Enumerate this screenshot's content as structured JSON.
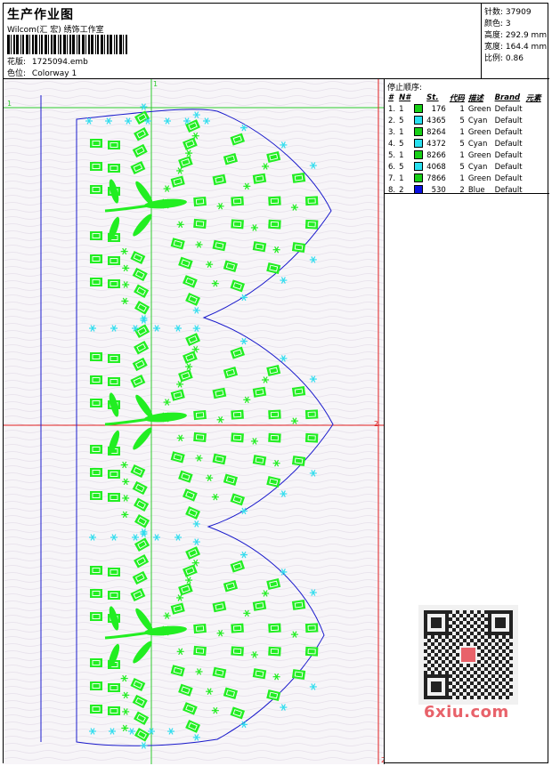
{
  "header": {
    "title": "生产作业图",
    "company": "Wilcom(汇 宏) 绣饰工作室",
    "design_label": "花版:",
    "design_value": "1725094.emb",
    "colorway_label": "色位:",
    "colorway_value": "Colorway 1"
  },
  "stats": [
    {
      "label": "针数:",
      "value": "37909"
    },
    {
      "label": "颜色:",
      "value": "3"
    },
    {
      "label": "高度:",
      "value": "292.9 mm"
    },
    {
      "label": "宽度:",
      "value": "164.4 mm"
    },
    {
      "label": "比例:",
      "value": "0.86"
    }
  ],
  "stop_sequence": {
    "title": "停止顺序:",
    "columns": [
      "#",
      "N#",
      "St.",
      "代码",
      "描述",
      "Brand",
      "元素"
    ],
    "rows": [
      {
        "index": "1.",
        "needle": "1",
        "color": "#18d018",
        "stitches": "176",
        "code": "1",
        "description": "Green",
        "brand": "Default"
      },
      {
        "index": "2.",
        "needle": "5",
        "color": "#29e0f0",
        "stitches": "4365",
        "code": "5",
        "description": "Cyan",
        "brand": "Default"
      },
      {
        "index": "3.",
        "needle": "1",
        "color": "#18d018",
        "stitches": "8264",
        "code": "1",
        "description": "Green",
        "brand": "Default"
      },
      {
        "index": "4.",
        "needle": "5",
        "color": "#29e0f0",
        "stitches": "4372",
        "code": "5",
        "description": "Cyan",
        "brand": "Default"
      },
      {
        "index": "5.",
        "needle": "1",
        "color": "#18d018",
        "stitches": "8266",
        "code": "1",
        "description": "Green",
        "brand": "Default"
      },
      {
        "index": "6.",
        "needle": "5",
        "color": "#29e0f0",
        "stitches": "4068",
        "code": "5",
        "description": "Cyan",
        "brand": "Default"
      },
      {
        "index": "7.",
        "needle": "1",
        "color": "#18d018",
        "stitches": "7866",
        "code": "1",
        "description": "Green",
        "brand": "Default"
      },
      {
        "index": "8.",
        "needle": "2",
        "color": "#0a10e0",
        "stitches": "530",
        "code": "2",
        "description": "Blue",
        "brand": "Default"
      }
    ]
  },
  "canvas": {
    "marker_left": "1",
    "marker_top": "1",
    "marker_right": "2",
    "marker_bottom": "2",
    "outline_color": "#1a1acc",
    "green": "#22ee22",
    "cyan": "#33ddee",
    "guide_green": "#2ecc2e",
    "guide_red": "#e02020"
  },
  "watermark": {
    "site": "6xiu.com",
    "stamp_icon": "qr-code-icon"
  }
}
